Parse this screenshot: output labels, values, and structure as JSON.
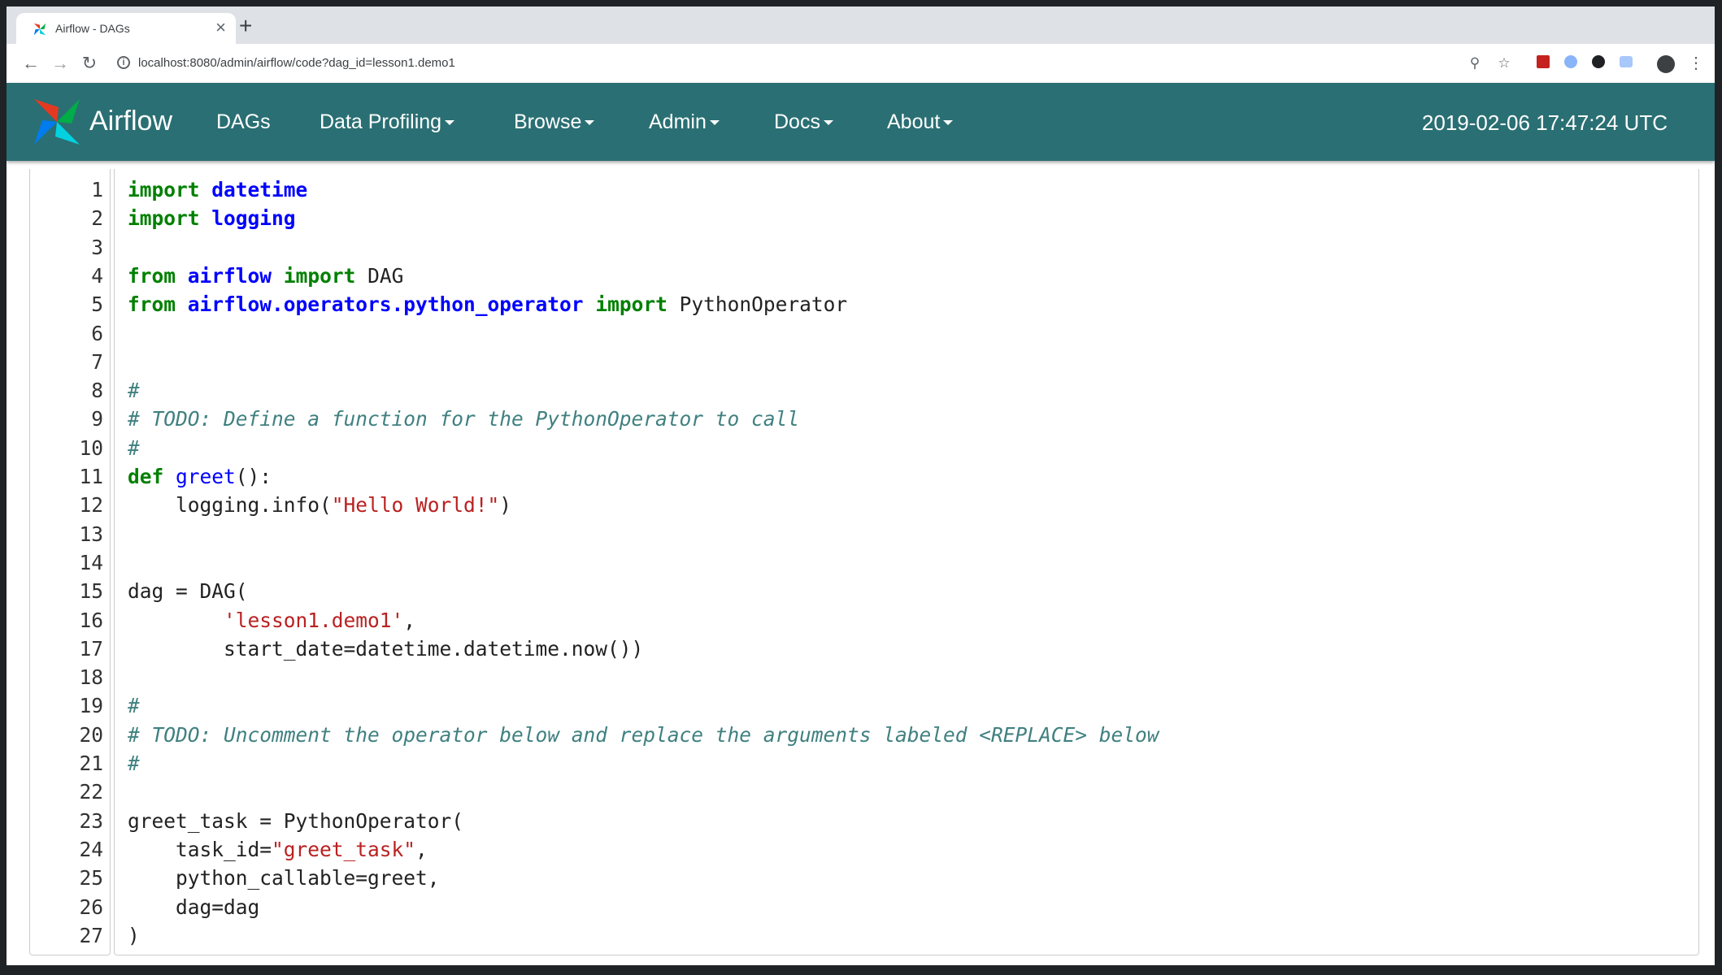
{
  "browser": {
    "tab_title": "Airflow - DAGs",
    "tab_close": "×",
    "new_tab": "+",
    "url": "localhost:8080/admin/airflow/code?dag_id=lesson1.demo1"
  },
  "navbar": {
    "brand": "Airflow",
    "items": [
      {
        "label": "DAGs",
        "dropdown": false
      },
      {
        "label": "Data Profiling",
        "dropdown": true
      },
      {
        "label": "Browse",
        "dropdown": true
      },
      {
        "label": "Admin",
        "dropdown": true
      },
      {
        "label": "Docs",
        "dropdown": true
      },
      {
        "label": "About",
        "dropdown": true
      }
    ],
    "clock": "2019-02-06 17:47:24 UTC",
    "color": "#2a6f73"
  },
  "code": {
    "line_numbers": [
      "1",
      "2",
      "3",
      "4",
      "5",
      "6",
      "7",
      "8",
      "9",
      "10",
      "11",
      "12",
      "13",
      "14",
      "15",
      "16",
      "17",
      "18",
      "19",
      "20",
      "21",
      "22",
      "23",
      "24",
      "25",
      "26",
      "27"
    ],
    "lines": [
      [
        {
          "t": "import",
          "c": "kw"
        },
        {
          "t": " ",
          "c": "pl"
        },
        {
          "t": "datetime",
          "c": "nm"
        }
      ],
      [
        {
          "t": "import",
          "c": "kw"
        },
        {
          "t": " ",
          "c": "pl"
        },
        {
          "t": "logging",
          "c": "nm"
        }
      ],
      [],
      [
        {
          "t": "from",
          "c": "kw"
        },
        {
          "t": " ",
          "c": "pl"
        },
        {
          "t": "airflow",
          "c": "nm"
        },
        {
          "t": " ",
          "c": "pl"
        },
        {
          "t": "import",
          "c": "kw"
        },
        {
          "t": " DAG",
          "c": "pl"
        }
      ],
      [
        {
          "t": "from",
          "c": "kw"
        },
        {
          "t": " ",
          "c": "pl"
        },
        {
          "t": "airflow.operators.python_operator",
          "c": "nm"
        },
        {
          "t": " ",
          "c": "pl"
        },
        {
          "t": "import",
          "c": "kw"
        },
        {
          "t": " PythonOperator",
          "c": "pl"
        }
      ],
      [],
      [],
      [
        {
          "t": "#",
          "c": "cm"
        }
      ],
      [
        {
          "t": "# TODO: Define a function for the PythonOperator to call",
          "c": "cm"
        }
      ],
      [
        {
          "t": "#",
          "c": "cm"
        }
      ],
      [
        {
          "t": "def",
          "c": "kw"
        },
        {
          "t": " ",
          "c": "pl"
        },
        {
          "t": "greet",
          "c": "fn"
        },
        {
          "t": "():",
          "c": "pl"
        }
      ],
      [
        {
          "t": "    logging.info(",
          "c": "pl"
        },
        {
          "t": "\"Hello World!\"",
          "c": "st"
        },
        {
          "t": ")",
          "c": "pl"
        }
      ],
      [],
      [],
      [
        {
          "t": "dag = DAG(",
          "c": "pl"
        }
      ],
      [
        {
          "t": "        ",
          "c": "pl"
        },
        {
          "t": "'lesson1.demo1'",
          "c": "st"
        },
        {
          "t": ",",
          "c": "pl"
        }
      ],
      [
        {
          "t": "        start_date=datetime.datetime.now())",
          "c": "pl"
        }
      ],
      [],
      [
        {
          "t": "#",
          "c": "cm"
        }
      ],
      [
        {
          "t": "# TODO: Uncomment the operator below and replace the arguments labeled <REPLACE> below",
          "c": "cm"
        }
      ],
      [
        {
          "t": "#",
          "c": "cm"
        }
      ],
      [],
      [
        {
          "t": "greet_task = ",
          "c": "pl"
        },
        {
          "t": "PythonOperator(",
          "c": "pl"
        }
      ],
      [
        {
          "t": "    task_id=",
          "c": "pl"
        },
        {
          "t": "\"greet_task\"",
          "c": "st"
        },
        {
          "t": ",",
          "c": "pl"
        }
      ],
      [
        {
          "t": "    python_callable=greet,",
          "c": "pl"
        }
      ],
      [
        {
          "t": "    dag=dag",
          "c": "pl"
        }
      ],
      [
        {
          "t": ")",
          "c": "pl"
        }
      ]
    ]
  }
}
